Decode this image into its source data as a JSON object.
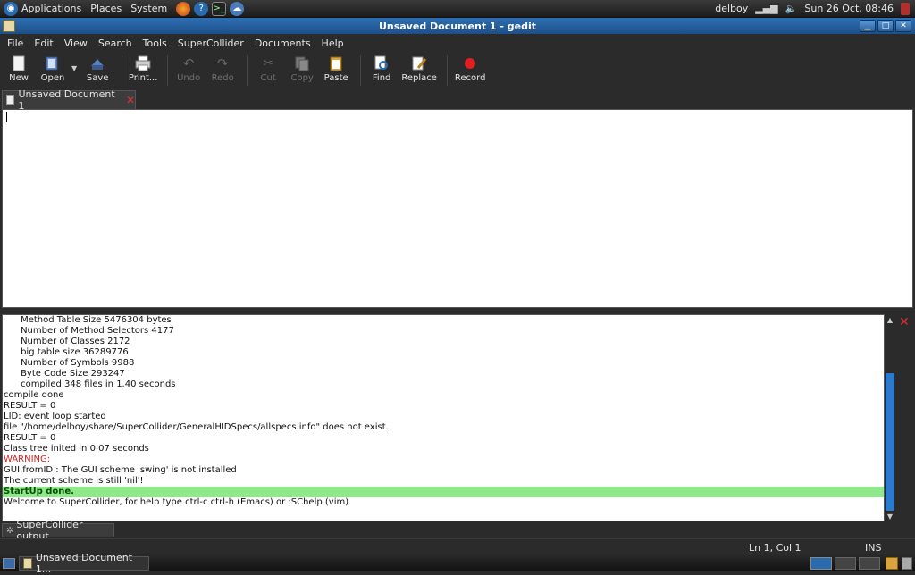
{
  "top_panel": {
    "menus": [
      "Applications",
      "Places",
      "System"
    ],
    "user": "delboy",
    "clock": "Sun 26 Oct, 08:46"
  },
  "window": {
    "title": "Unsaved Document 1 - gedit"
  },
  "menubar": {
    "items": [
      "File",
      "Edit",
      "View",
      "Search",
      "Tools",
      "SuperCollider",
      "Documents",
      "Help"
    ]
  },
  "toolbar": {
    "new": "New",
    "open": "Open",
    "save": "Save",
    "print": "Print...",
    "undo": "Undo",
    "redo": "Redo",
    "cut": "Cut",
    "copy": "Copy",
    "paste": "Paste",
    "find": "Find",
    "replace": "Replace",
    "record": "Record"
  },
  "tab": {
    "label": "Unsaved Document 1"
  },
  "output": {
    "lines": [
      "      Method Table Size 5476304 bytes",
      "      Number of Method Selectors 4177",
      "      Number of Classes 2172",
      "      big table size 36289776",
      "      Number of Symbols 9988",
      "      Byte Code Size 293247",
      "      compiled 348 files in 1.40 seconds",
      "compile done",
      "RESULT = 0",
      "LID: event loop started",
      "file \"/home/delboy/share/SuperCollider/GeneralHIDSpecs/allspecs.info\" does not exist.",
      "RESULT = 0",
      "Class tree inited in 0.07 seconds",
      "WARNING:",
      "GUI.fromID : The GUI scheme 'swing' is not installed",
      "The current scheme is still 'nil'!",
      "StartUp done.",
      "Welcome to SuperCollider, for help type ctrl-c ctrl-h (Emacs) or :SChelp (vim)"
    ]
  },
  "bottom_tab": {
    "label": "SuperCollider output"
  },
  "status": {
    "position": "Ln 1, Col 1",
    "mode": "INS"
  },
  "taskbar": {
    "task_label": "Unsaved Document 1..."
  },
  "colors": {
    "titlebar": "#2f6fb1",
    "highlight_line": "#8fe88a",
    "warning": "#d02020",
    "scroll_thumb": "#2a7ad0"
  }
}
